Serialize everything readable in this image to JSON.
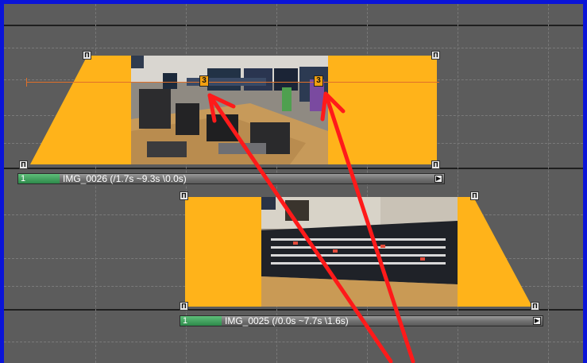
{
  "timeline": {
    "track1": {
      "clip_number": "1",
      "clip_label": "IMG_0026 (/1.7s ~9.3s \\0.0s)",
      "marker_left": "3",
      "marker_right": "3"
    },
    "track2": {
      "clip_number": "1",
      "clip_label": "IMG_0025 (/0.0s ~7.7s \\1.6s)"
    }
  },
  "colors": {
    "border": "#0a14d8",
    "background": "#5c5c5c",
    "envelope": "#ffb31a",
    "annotation_arrow": "#ff1a1a"
  },
  "icons": {
    "handle": "bracket-handle-icon",
    "play": "play-triangle-icon"
  }
}
